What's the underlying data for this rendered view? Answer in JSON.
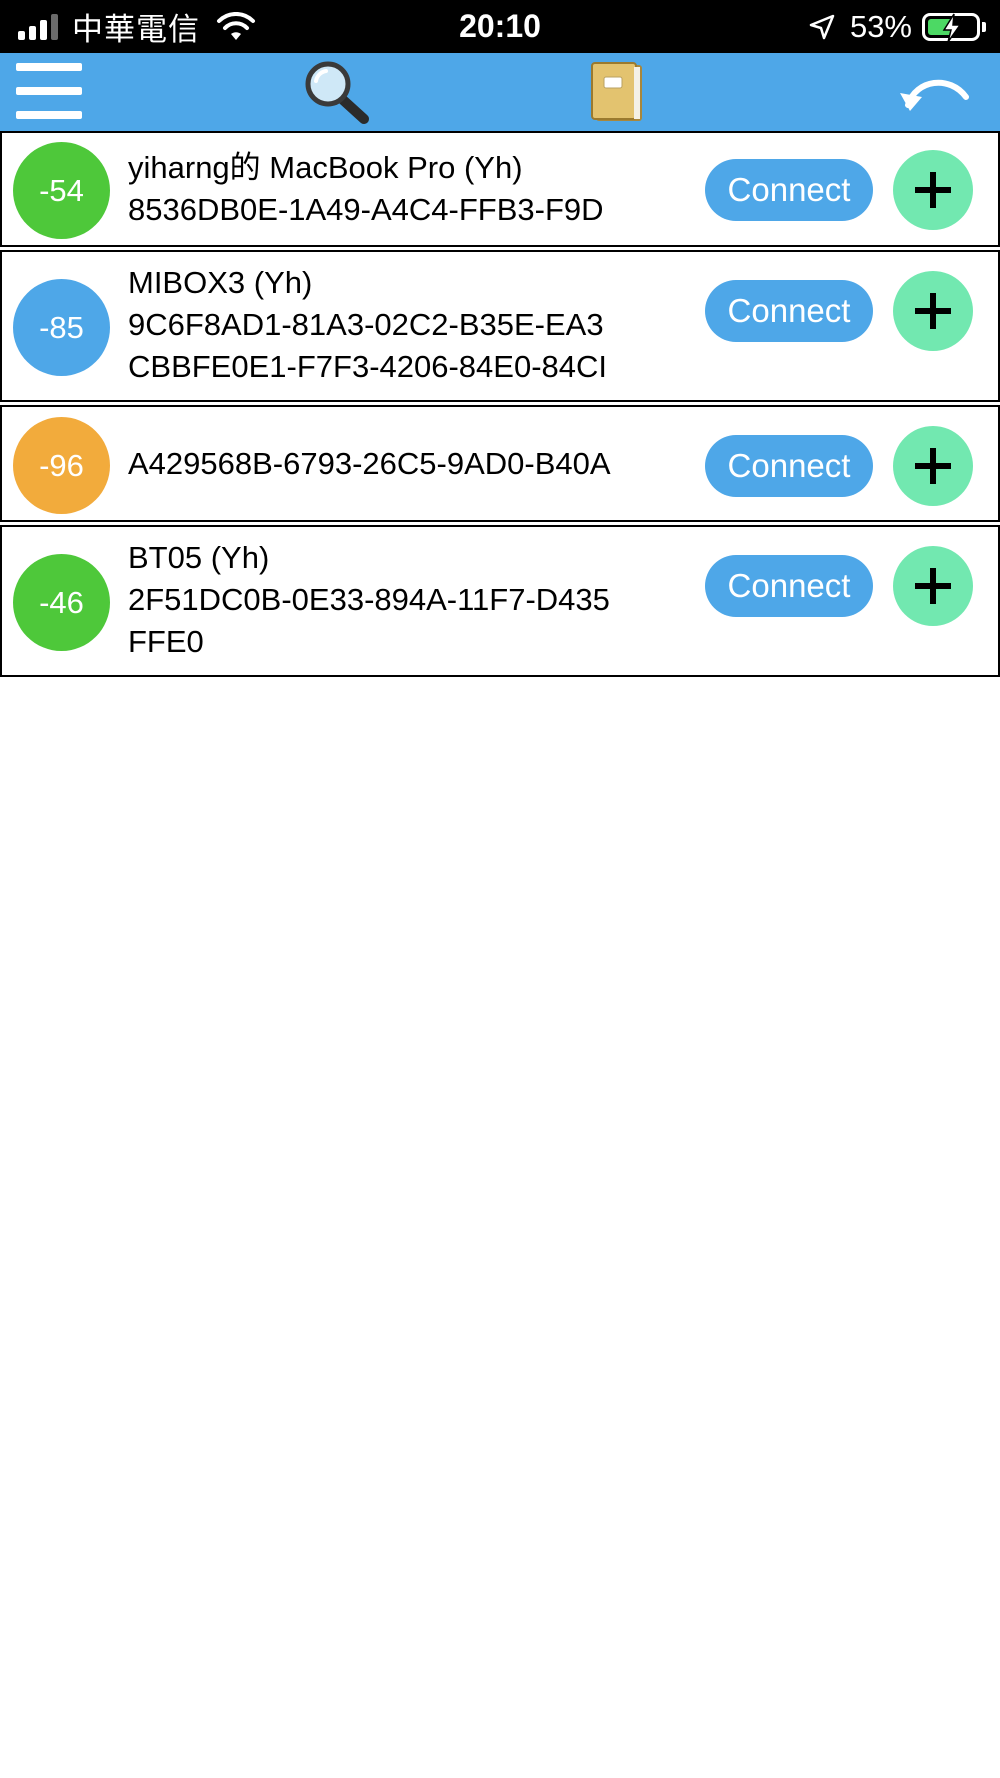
{
  "status_bar": {
    "carrier": "中華電信",
    "time": "20:10",
    "battery_percent": "53%",
    "signal_bars": 3,
    "battery_level": 0.53,
    "icons": [
      "signal-icon",
      "wifi-icon",
      "location-arrow-icon",
      "battery-charging-icon"
    ]
  },
  "toolbar": {
    "icons": [
      "menu-icon",
      "search-icon",
      "book-icon",
      "undo-icon"
    ],
    "color": "#4ea7e8"
  },
  "devices": [
    {
      "rssi": "-54",
      "color": "#4ec83a",
      "lines": [
        "yiharng的 MacBook Pro (Yh)",
        "8536DB0E-1A49-A4C4-FFB3-F9D"
      ],
      "connect_label": "Connect"
    },
    {
      "rssi": "-85",
      "color": "#4ea7e8",
      "lines": [
        "MIBOX3 (Yh)",
        "9C6F8AD1-81A3-02C2-B35E-EA3",
        "CBBFE0E1-F7F3-4206-84E0-84CI"
      ],
      "connect_label": "Connect"
    },
    {
      "rssi": "-96",
      "color": "#f2ab3c",
      "lines": [
        "A429568B-6793-26C5-9AD0-B40A"
      ],
      "connect_label": "Connect"
    },
    {
      "rssi": "-46",
      "color": "#4ec83a",
      "lines": [
        "BT05 (Yh)",
        "2F51DC0B-0E33-894A-11F7-D435",
        "FFE0"
      ],
      "connect_label": "Connect"
    }
  ],
  "colors": {
    "accent": "#4ea7e8",
    "add_button": "#72e8b0",
    "rssi_good": "#4ec83a",
    "rssi_fair": "#4ea7e8",
    "rssi_weak": "#f2ab3c"
  }
}
